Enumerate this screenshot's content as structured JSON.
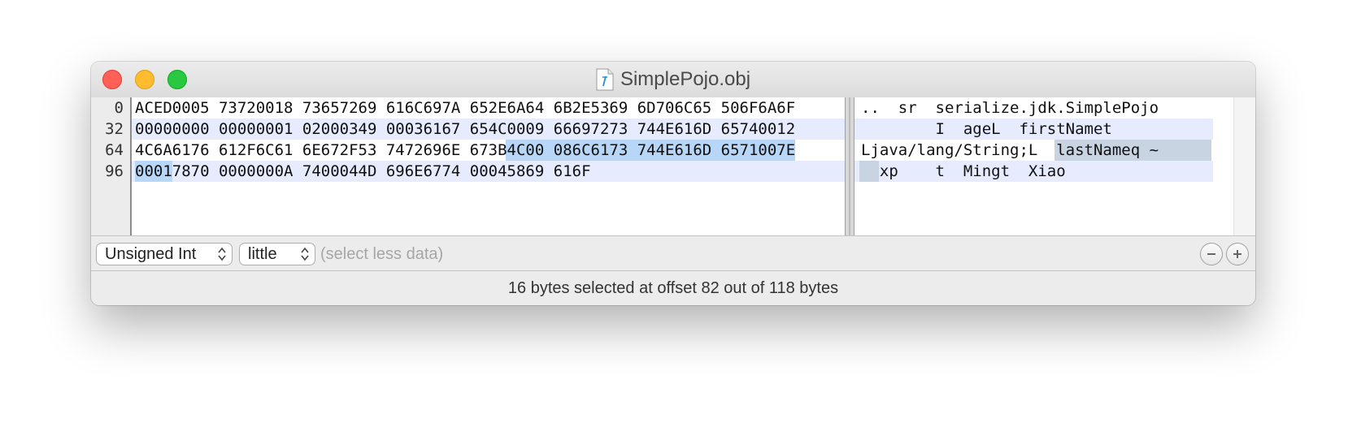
{
  "window": {
    "title": "SimplePojo.obj"
  },
  "hex_view": {
    "line_offsets": [
      "0",
      "32",
      "64",
      "96"
    ],
    "rows": [
      "ACED0005 73720018 73657269 616C697A 652E6A64 6B2E5369 6D706C65 506F6A6F",
      "00000000 00000001 02000349 00036167 654C0009 66697273 744E616D 65740012",
      "4C6A6176 612F6C61 6E672F53 7472696E 673B4C00 086C6173 744E616D 6571007E",
      "00017870 0000000A 7400044D 696E6774 00045869 616F"
    ]
  },
  "ascii_view": {
    "rows": [
      "..  sr  serialize.jdk.SimplePojo",
      "        I  ageL  firstNamet",
      "Ljava/lang/String;L  lastNameq ~",
      "  xp    t  Mingt  Xiao"
    ]
  },
  "toolbar": {
    "type_popup": "Unsigned Int",
    "endian_popup": "little",
    "hint": "(select less data)"
  },
  "status": {
    "text": "16 bytes selected at offset 82 out of 118 bytes"
  },
  "colors": {
    "selection": "#b8d6f8",
    "alt_row_stripe": "#e6ecfe",
    "close": "#fe5f57",
    "minimize": "#febc2e",
    "maximize": "#28c840"
  }
}
